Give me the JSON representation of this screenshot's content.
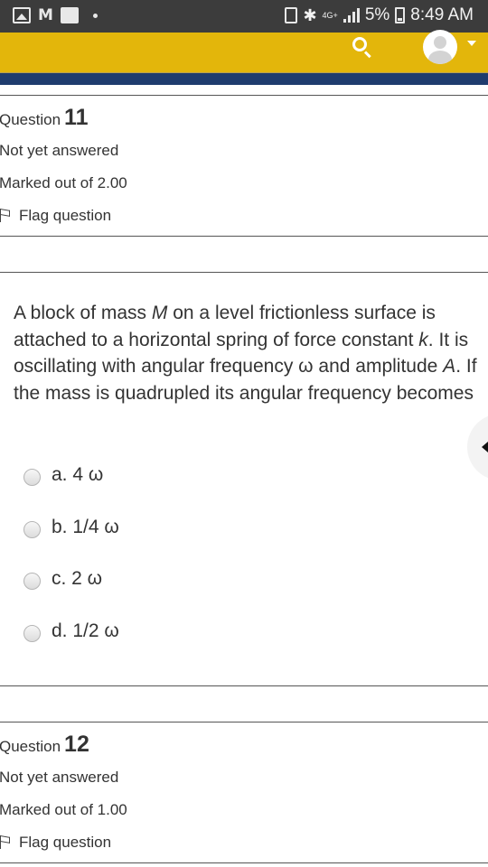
{
  "status_bar": {
    "left_icons": [
      "gallery-icon",
      "gmail-icon",
      "pulse-icon",
      "dot-icon"
    ],
    "gmail_glyph": "M",
    "network": "4G+",
    "battery_percent": "5%",
    "time": "8:49 AM"
  },
  "header": {
    "accent_color": "#e3b60b",
    "secondary_color": "#1f3c6e",
    "icons": [
      "search-icon",
      "user-avatar-icon",
      "chevron-down-icon"
    ]
  },
  "question_11": {
    "label": "Question",
    "number": "11",
    "state": "Not yet answered",
    "marks": "Marked out of 2.00",
    "flag_label": "Flag question",
    "text": {
      "p1": "A block of mass ",
      "mass_var": "M",
      "p2": " on a level frictionless surface is attached to a horizontal spring of force constant ",
      "k_var": "k",
      "p3": ". It is oscillating with angular frequency ω and amplitude ",
      "amp_var": "A",
      "p4": ". If the mass is quadrupled its angular frequency becomes"
    },
    "answers": [
      {
        "label": "a. 4 ω",
        "selected": false
      },
      {
        "label": "b. 1/4 ω",
        "selected": false
      },
      {
        "label": "c. 2 ω",
        "selected": false
      },
      {
        "label": "d. 1/2 ω",
        "selected": false
      }
    ]
  },
  "question_12": {
    "label": "Question",
    "number": "12",
    "state": "Not yet answered",
    "marks": "Marked out of 1.00",
    "flag_label": "Flag question"
  }
}
